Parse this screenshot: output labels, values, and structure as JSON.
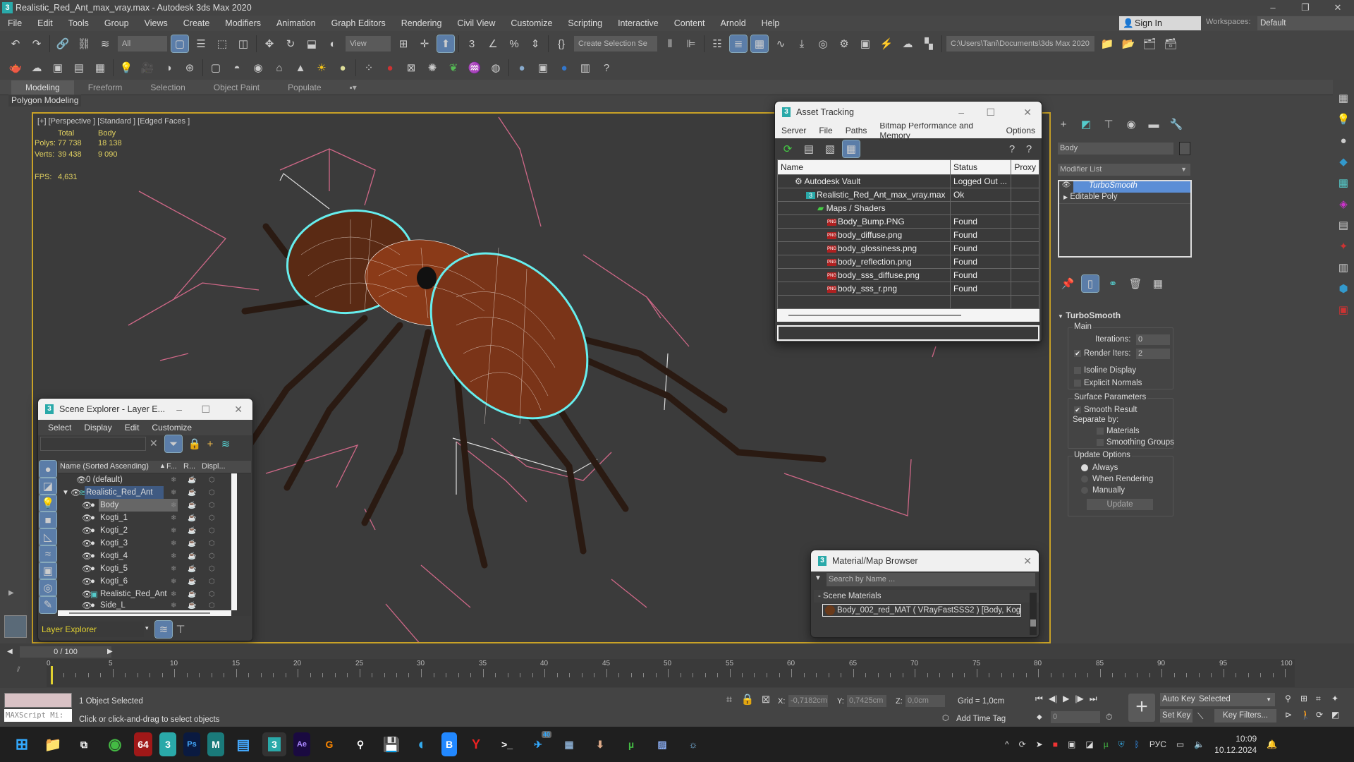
{
  "window": {
    "title": "Realistic_Red_Ant_max_vray.max - Autodesk 3ds Max 2020",
    "min": "–",
    "max": "❐",
    "close": "✕"
  },
  "menu": [
    "File",
    "Edit",
    "Tools",
    "Group",
    "Views",
    "Create",
    "Modifiers",
    "Animation",
    "Graph Editors",
    "Rendering",
    "Civil View",
    "Customize",
    "Scripting",
    "Interactive",
    "Content",
    "Arnold",
    "Help"
  ],
  "account": {
    "sign_in": "Sign In",
    "workspaces_label": "Workspaces:",
    "workspace": "Default"
  },
  "toolbar": {
    "selection_filter": "All",
    "ref_coord": "View",
    "named_selection": "Create Selection Se",
    "project_path": "C:\\Users\\Tani\\Documents\\3ds Max 2020"
  },
  "ribbon": {
    "tabs": [
      "Modeling",
      "Freeform",
      "Selection",
      "Object Paint",
      "Populate"
    ],
    "panel": "Polygon Modeling"
  },
  "viewport": {
    "label": "[+] [Perspective ] [Standard ] [Edged Faces ]",
    "stats": {
      "total_h": "Total",
      "body_h": "Body",
      "polys_l": "Polys:",
      "polys_total": "77 738",
      "polys_body": "18 138",
      "verts_l": "Verts:",
      "verts_total": "39 438",
      "verts_body": "9 090",
      "fps_l": "FPS:",
      "fps": "4,631"
    }
  },
  "asset_tracking": {
    "title": "Asset Tracking",
    "menu": [
      "Server",
      "File",
      "Paths",
      "Bitmap Performance and Memory",
      "Options"
    ],
    "columns": [
      "Name",
      "Status",
      "Proxy"
    ],
    "rows": [
      {
        "name": "Autodesk Vault",
        "status": "Logged Out ...",
        "level": 1
      },
      {
        "name": "Realistic_Red_Ant_max_vray.max",
        "status": "Ok",
        "level": 2
      },
      {
        "name": "Maps / Shaders",
        "status": "",
        "level": 3
      },
      {
        "name": "Body_Bump.PNG",
        "status": "Found",
        "level": 4
      },
      {
        "name": "body_diffuse.png",
        "status": "Found",
        "level": 4
      },
      {
        "name": "body_glossiness.png",
        "status": "Found",
        "level": 4
      },
      {
        "name": "body_reflection.png",
        "status": "Found",
        "level": 4
      },
      {
        "name": "body_sss_diffuse.png",
        "status": "Found",
        "level": 4
      },
      {
        "name": "body_sss_r.png",
        "status": "Found",
        "level": 4
      }
    ]
  },
  "scene_explorer": {
    "title": "Scene Explorer - Layer E...",
    "menu": [
      "Select",
      "Display",
      "Edit",
      "Customize"
    ],
    "columns": [
      "Name (Sorted Ascending)",
      "F...",
      "R...",
      "Displ..."
    ],
    "rows": [
      {
        "name": "0 (default)"
      },
      {
        "name": "Realistic_Red_Ant"
      },
      {
        "name": "Body"
      },
      {
        "name": "Kogti_1"
      },
      {
        "name": "Kogti_2"
      },
      {
        "name": "Kogti_3"
      },
      {
        "name": "Kogti_4"
      },
      {
        "name": "Kogti_5"
      },
      {
        "name": "Kogti_6"
      },
      {
        "name": "Realistic_Red_Ant"
      },
      {
        "name": "Side_L"
      }
    ],
    "explorer_type": "Layer Explorer"
  },
  "material_browser": {
    "title": "Material/Map Browser",
    "search_placeholder": "Search by Name ...",
    "group": "- Scene Materials",
    "item": "Body_002_red_MAT ( VRayFastSSS2 ) [Body, Kog..."
  },
  "command_panel": {
    "object_name": "Body",
    "modifier_list": "Modifier List",
    "stack": [
      "TurboSmooth",
      "Editable Poly"
    ],
    "rollout": "TurboSmooth",
    "main": "Main",
    "iterations_l": "Iterations:",
    "iterations": "0",
    "render_iters_l": "Render Iters:",
    "render_iters": "2",
    "isoline": "Isoline Display",
    "explicit": "Explicit Normals",
    "surface": "Surface Parameters",
    "smooth_result": "Smooth Result",
    "separate_by": "Separate by:",
    "materials": "Materials",
    "smoothing_groups": "Smoothing Groups",
    "update_options": "Update Options",
    "always": "Always",
    "when_rendering": "When Rendering",
    "manually": "Manually",
    "update": "Update"
  },
  "timeline": {
    "frame": "0 / 100",
    "ticks": [
      "0",
      "5",
      "10",
      "15",
      "20",
      "25",
      "30",
      "35",
      "40",
      "45",
      "50",
      "55",
      "60",
      "65",
      "70",
      "75",
      "80",
      "85",
      "90",
      "95",
      "100"
    ]
  },
  "status": {
    "maxscript": "MAXScript Mi:",
    "selected": "1 Object Selected",
    "prompt": "Click or click-and-drag to select objects",
    "x_l": "X:",
    "x": "-0,7182cm",
    "y_l": "Y:",
    "y": "0,7425cm",
    "z_l": "Z:",
    "z": "0,0cm",
    "grid": "Grid = 1,0cm",
    "add_time_tag": "Add Time Tag",
    "auto_key": "Auto Key",
    "set_key": "Set Key",
    "key_mode": "Selected",
    "key_filters": "Key Filters...",
    "current_frame": "0"
  },
  "taskbar": {
    "lang": "РУС",
    "time": "10:09",
    "date": "10.12.2024",
    "badge": "40"
  }
}
